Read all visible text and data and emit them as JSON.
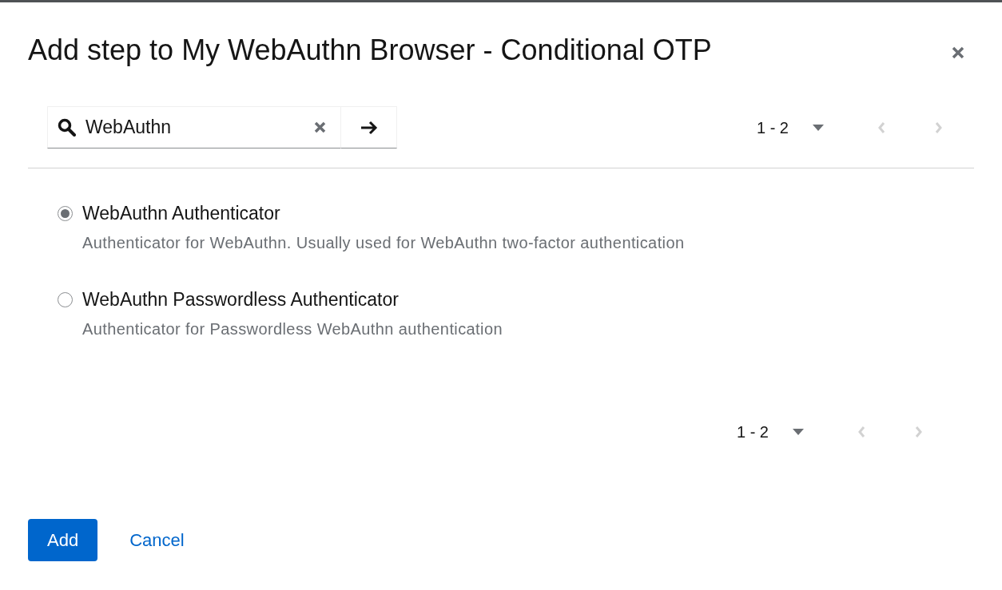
{
  "dialog": {
    "title": "Add step to My WebAuthn Browser - Conditional OTP"
  },
  "search": {
    "value": "WebAuthn"
  },
  "pagination_top": {
    "range": "1 - 2",
    "prev_disabled": true,
    "next_disabled": true
  },
  "options": [
    {
      "label": "WebAuthn Authenticator",
      "description": "Authenticator for WebAuthn. Usually used for WebAuthn two-factor authentication",
      "selected": true
    },
    {
      "label": "WebAuthn Passwordless Authenticator",
      "description": "Authenticator for Passwordless WebAuthn authentication",
      "selected": false
    }
  ],
  "pagination_bottom": {
    "range": "1 - 2",
    "prev_disabled": true,
    "next_disabled": true
  },
  "buttons": [
    {
      "label": "Add",
      "kind": "primary"
    },
    {
      "label": "Cancel",
      "kind": "link"
    }
  ]
}
